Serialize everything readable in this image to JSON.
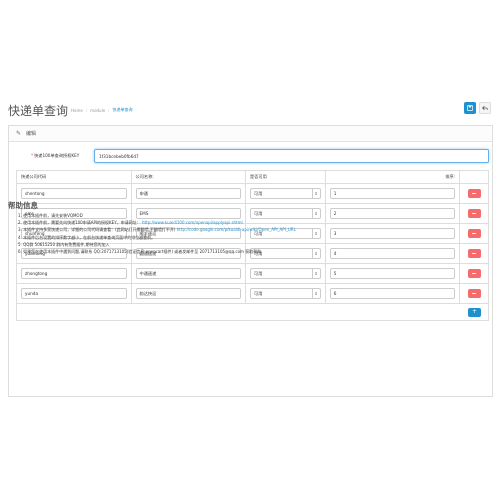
{
  "header": {
    "title": "快递单查询",
    "breadcrumb": [
      "Home",
      "module",
      "快递单查询"
    ],
    "save_icon": "save-icon",
    "back_icon": "reply-icon"
  },
  "panel": {
    "heading": "编辑",
    "key_label": "快递100单查询授权KEY",
    "key_value": "1f31bcebeb0fb6d7"
  },
  "table": {
    "headers": [
      "快递公司代码",
      "公司名称:",
      "是否可用",
      "排序:"
    ],
    "rows": [
      {
        "code": "shentong",
        "name": "申通",
        "status": "可用",
        "sort": "1"
      },
      {
        "code": "ems",
        "name": "EMS",
        "status": "可用",
        "sort": "2"
      },
      {
        "code": "shunfeng",
        "name": "顺丰速运",
        "status": "可用",
        "sort": "3"
      },
      {
        "code": "yuantong",
        "name": "圆通速递",
        "status": "可用",
        "sort": "4"
      },
      {
        "code": "zhongtong",
        "name": "中通速递",
        "status": "可用",
        "sort": "5"
      },
      {
        "code": "yunda",
        "name": "韵达快运",
        "status": "可用",
        "sort": "6"
      }
    ]
  },
  "help": {
    "title": "帮助信息",
    "items": [
      {
        "text": "1. 使用本插件前，请先安装VQMOD",
        "link": ""
      },
      {
        "text": "2. 使用本插件前，需要先向快递100申请API的授权KEY，申请网址：",
        "link": "http://www.kuaidi100.com/openapi/applyapi.shtml"
      },
      {
        "text": "3. 本插件支持多家快递公司，详细的公司代码请查看：(此网站打开需翻墙,不翻墙打不开)",
        "link": "http://code.google.com/p/kuaidi-api/wiki/Open_API_API_URL"
      },
      {
        "text": "4. 本插件后台设置的排序数字越小，在前台快递单查询页面中的排位越靠前。",
        "link": ""
      },
      {
        "text": "5. QQ群 50615250 群内有免费插件,期待您的加入",
        "link": ""
      },
      {
        "text": "6. 如果您在使用本插件中遇到问题,请联系 QQ:2071713105(验证信息:opencart插件) 或者发邮件至 2071713105@qq.com 获取帮助",
        "link": ""
      }
    ]
  }
}
